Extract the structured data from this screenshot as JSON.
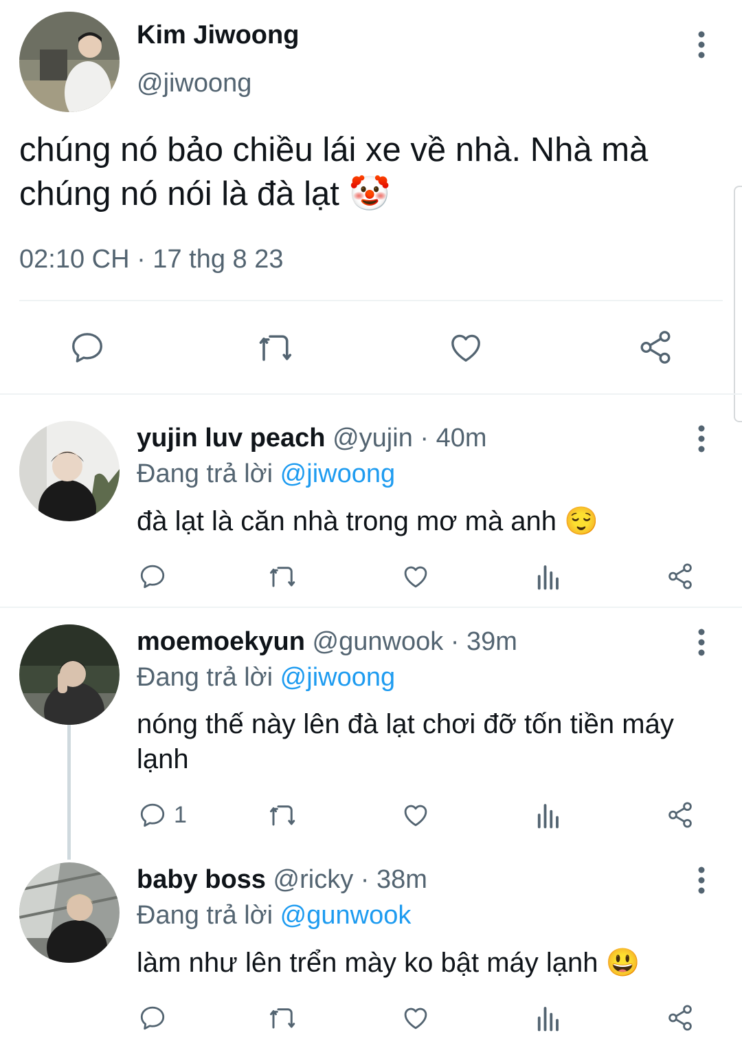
{
  "main_tweet": {
    "display_name": "Kim Jiwoong",
    "handle": "@jiwoong",
    "text_line1": "chúng nó bảo chiều lái xe về nhà. Nhà mà",
    "text_line2": "chúng nó nói là đà lạt",
    "emoji": "🤡",
    "timestamp": "02:10 CH · 17 thg 8 23"
  },
  "replies": [
    {
      "display_name": "yujin luv peach",
      "handle_time": "@yujin · 40m",
      "replying_label": "Đang trả lời",
      "replying_to": "@jiwoong",
      "text": "đà lạt là căn nhà trong mơ mà anh",
      "emoji": "😌",
      "reply_count": ""
    },
    {
      "display_name": "moemoekyun",
      "handle_time": "@gunwook · 39m",
      "replying_label": "Đang trả lời",
      "replying_to": "@jiwoong",
      "text_line1": "nóng thế này lên đà lạt chơi đỡ tốn tiền máy",
      "text_line2": "lạnh",
      "reply_count": "1"
    },
    {
      "display_name": "baby boss",
      "handle_time": "@ricky · 38m",
      "replying_label": "Đang trả lời",
      "replying_to": "@gunwook",
      "text": "làm như lên trển mày ko bật máy lạnh",
      "emoji": "😃",
      "reply_count": ""
    }
  ],
  "colors": {
    "text": "#0f1419",
    "secondary": "#536471",
    "link": "#1d9bf0",
    "divider": "#eff3f4"
  },
  "icons": [
    "more-vertical-icon",
    "reply-icon",
    "retweet-icon",
    "like-icon",
    "views-icon",
    "share-icon"
  ]
}
